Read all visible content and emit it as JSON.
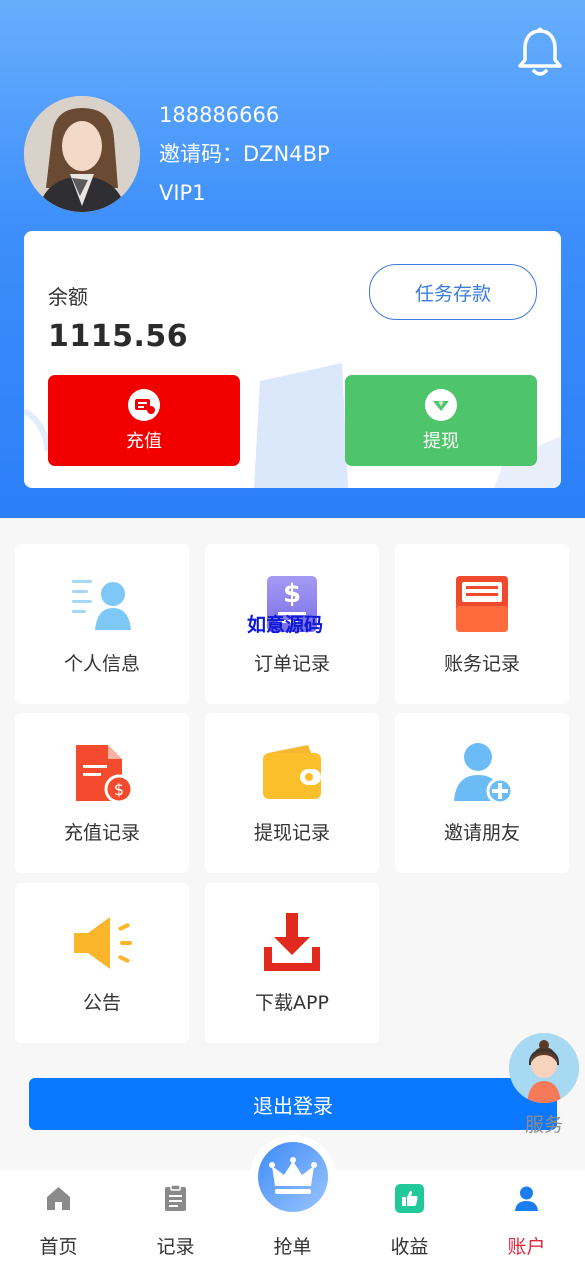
{
  "user": {
    "phone": "188886666",
    "invite_code": "邀请码：DZN4BP",
    "vip": "VIP1"
  },
  "balance": {
    "label": "余额",
    "value": "1115.56",
    "task_deposit": "任务存款"
  },
  "actions": {
    "recharge": "充值",
    "withdraw": "提现"
  },
  "grid": [
    {
      "label": "个人信息",
      "icon": "user-info-icon"
    },
    {
      "label": "订单记录",
      "icon": "order-icon"
    },
    {
      "label": "账务记录",
      "icon": "ledger-icon"
    },
    {
      "label": "充值记录",
      "icon": "recharge-record-icon"
    },
    {
      "label": "提现记录",
      "icon": "wallet-icon"
    },
    {
      "label": "邀请朋友",
      "icon": "invite-friend-icon"
    },
    {
      "label": "公告",
      "icon": "megaphone-icon"
    },
    {
      "label": "下载APP",
      "icon": "download-icon"
    }
  ],
  "watermark": "如意源码",
  "logout": "退出登录",
  "service": "服务",
  "tabs": [
    {
      "label": "首页",
      "icon": "home-icon"
    },
    {
      "label": "记录",
      "icon": "clipboard-icon"
    },
    {
      "label": "抢单",
      "icon": "crown-icon"
    },
    {
      "label": "收益",
      "icon": "thumbs-up-icon"
    },
    {
      "label": "账户",
      "icon": "person-icon"
    }
  ],
  "colors": {
    "header_blue": "#2b7ff7",
    "recharge_red": "#f20000",
    "withdraw_green": "#4ec56b",
    "logout_blue": "#0a78ff",
    "active_tab": "#e0283f"
  }
}
